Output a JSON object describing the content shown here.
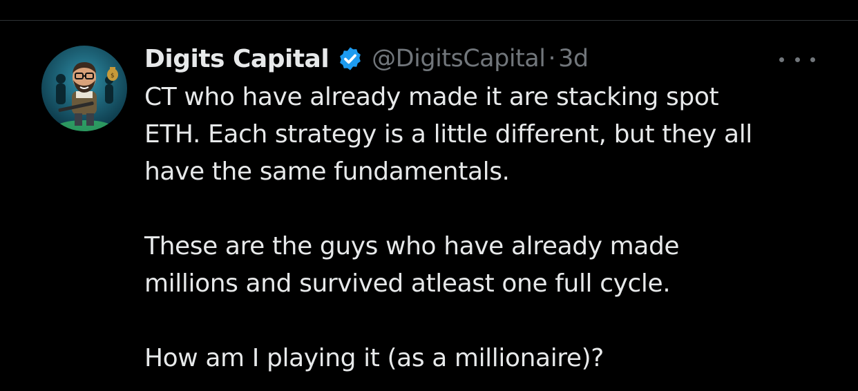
{
  "tweet": {
    "author": {
      "display_name": "Digits Capital",
      "handle": "@DigitsCapital",
      "verified": true,
      "avatar_icon": "cartoon-avatar-icon"
    },
    "separator": "·",
    "timestamp": "3d",
    "menu_icon": "more-options-icon",
    "paragraphs": [
      "CT who have already made it are stacking spot\nETH. Each strategy is a little different, but they all\nhave the same fundamentals.",
      "These are the guys who have already made\nmillions and survived atleast one full cycle.",
      "How am I playing it (as a millionaire)?"
    ]
  },
  "colors": {
    "background": "#000000",
    "text_primary": "#e7e9ea",
    "text_secondary": "#71767b",
    "verified_badge": "#1d9bf0",
    "divider": "#2f3336"
  }
}
